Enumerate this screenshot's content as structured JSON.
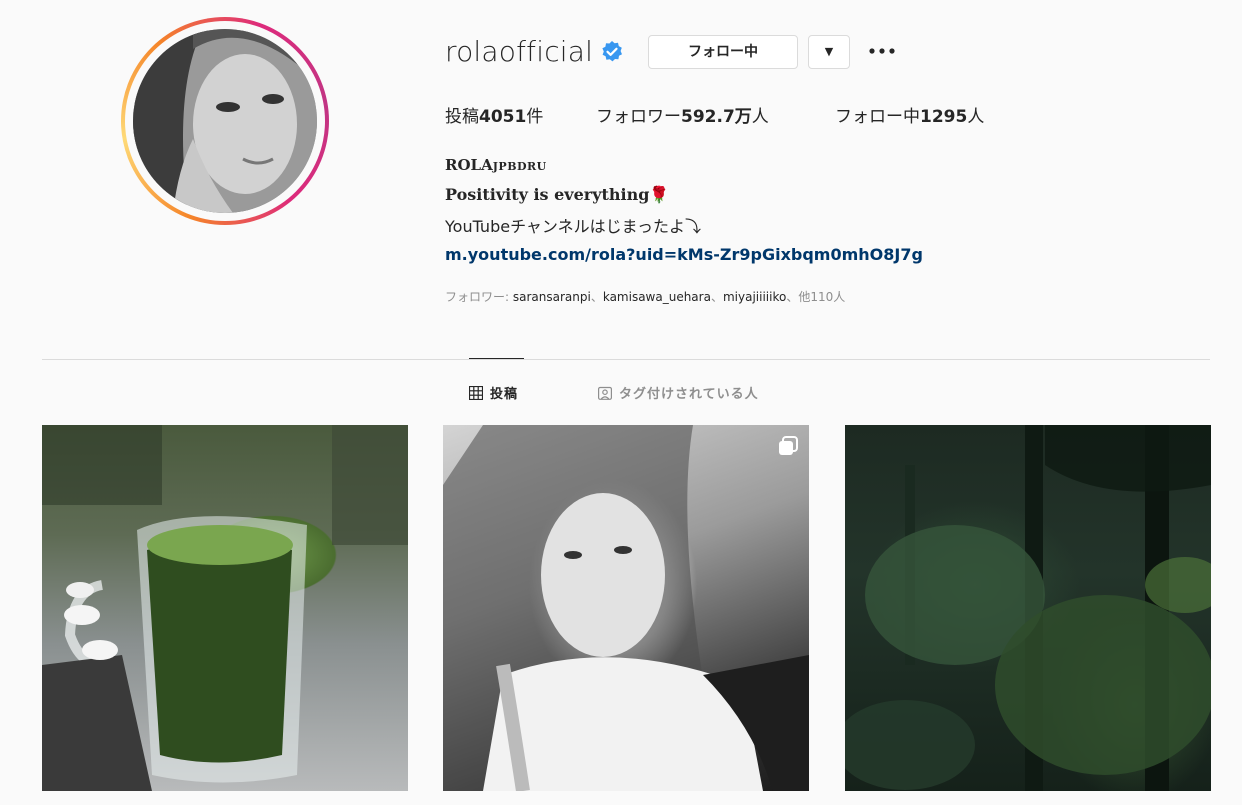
{
  "profile": {
    "username": "rolaofficial",
    "follow_label": "フォロー中",
    "stats": {
      "posts_label": "投稿",
      "posts_count": "4051",
      "posts_suffix": "件",
      "followers_label": "フォロワー",
      "followers_count": "592.7万",
      "followers_suffix": "人",
      "following_label": "フォロー中",
      "following_count": "1295",
      "following_suffix": "人"
    },
    "bio": {
      "name": "ROLA",
      "name_suffix": "JPBDRU",
      "line1": "Positivity is everything🌹",
      "line2": "YouTubeチャンネルはじまったよ⤵︎",
      "link": "m.youtube.com/rola?uid=kMs-Zr9pGixbqm0mhO8J7g"
    },
    "followed_by": {
      "prefix": "フォロワー: ",
      "accounts": [
        "saransaranpi",
        "kamisawa_uehara",
        "miyajiiiiiko"
      ],
      "separator": "、",
      "suffix": "他110人"
    }
  },
  "tabs": [
    {
      "label": "投稿",
      "active": true,
      "icon": "grid-icon"
    },
    {
      "label": "タグ付けされている人",
      "active": false,
      "icon": "tagged-user-icon"
    }
  ],
  "posts": [
    {
      "description_icon": "image"
    },
    {
      "description_icon": "image",
      "carousel": true
    },
    {
      "description_icon": "image"
    }
  ],
  "colors": {
    "link": "#00376b",
    "verified": "#3897f0",
    "muted": "#8e8e8e"
  }
}
